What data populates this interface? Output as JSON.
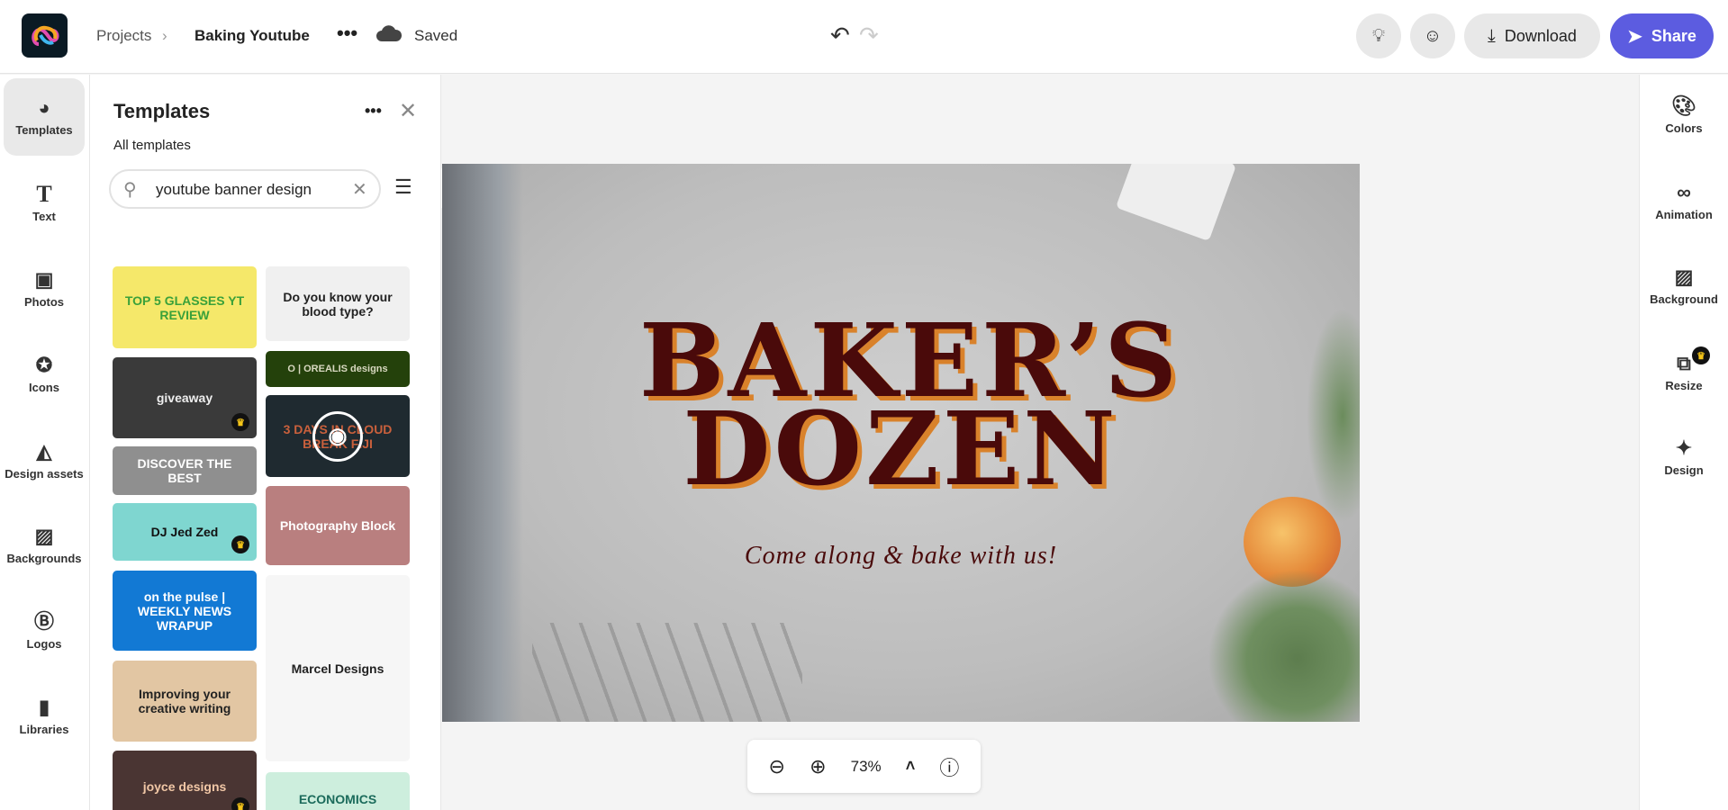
{
  "header": {
    "breadcrumb_root": "Projects",
    "project_name": "Baking Youtube",
    "save_status": "Saved",
    "download_label": "Download",
    "share_label": "Share"
  },
  "left_rail": [
    {
      "label": "Templates",
      "icon": "templates-icon"
    },
    {
      "label": "Text",
      "icon": "text-icon"
    },
    {
      "label": "Photos",
      "icon": "photos-icon"
    },
    {
      "label": "Icons",
      "icon": "icons-icon"
    },
    {
      "label": "Design assets",
      "icon": "design-assets-icon"
    },
    {
      "label": "Backgrounds",
      "icon": "backgrounds-icon"
    },
    {
      "label": "Logos",
      "icon": "logos-icon"
    },
    {
      "label": "Libraries",
      "icon": "libraries-icon"
    }
  ],
  "panel": {
    "title": "Templates",
    "subtitle": "All templates",
    "search_value": "youtube banner design",
    "thumbs": [
      {
        "text": "TOP 5 GLASSES YT REVIEW",
        "bg": "#f5e86a",
        "fg": "#3aa13a"
      },
      {
        "text": "Do you know your blood type?",
        "bg": "#f0f0f0",
        "fg": "#222"
      },
      {
        "text": "giveaway",
        "bg": "#3a3a3a",
        "fg": "#eee"
      },
      {
        "text": "O | OREALIS designs",
        "bg": "#24410b",
        "fg": "#d8d8c0"
      },
      {
        "text": "DISCOVER THE BEST",
        "bg": "#8f8f8f",
        "fg": "#fff"
      },
      {
        "text": "3 DAYS IN CLOUD BREAK FIJI",
        "bg": "#1f2a30",
        "fg": "#c9603c"
      },
      {
        "text": "DJ Jed Zed",
        "bg": "#7fd6d0",
        "fg": "#111"
      },
      {
        "text": "Photography Block",
        "bg": "#b97f7f",
        "fg": "#fff"
      },
      {
        "text": "on the pulse | WEEKLY NEWS WRAPUP",
        "bg": "#1279d4",
        "fg": "#fff"
      },
      {
        "text": "Marcel Designs",
        "bg": "#f6f6f6",
        "fg": "#222"
      },
      {
        "text": "Improving your creative writing",
        "bg": "#e2c6a3",
        "fg": "#222"
      },
      {
        "text": "ECONOMICS",
        "bg": "#cdeedd",
        "fg": "#1b6b5b"
      },
      {
        "text": "joyce designs",
        "bg": "#4a3533",
        "fg": "#f1c7a6"
      }
    ]
  },
  "canvas": {
    "title_line1": "BAKER’S",
    "title_line2": "DOZEN",
    "tagline": "Come along & bake with us!",
    "title_color": "#4a0a0a",
    "shadow_color": "#d9822b"
  },
  "zoom": {
    "level": "73%"
  },
  "right_rail": [
    {
      "label": "Colors",
      "icon": "palette-icon"
    },
    {
      "label": "Animation",
      "icon": "animation-icon"
    },
    {
      "label": "Background",
      "icon": "background-icon"
    },
    {
      "label": "Resize",
      "icon": "resize-icon",
      "premium": true
    },
    {
      "label": "Design",
      "icon": "magic-wand-icon"
    }
  ],
  "colors": {
    "accent": "#5c5ce0"
  }
}
